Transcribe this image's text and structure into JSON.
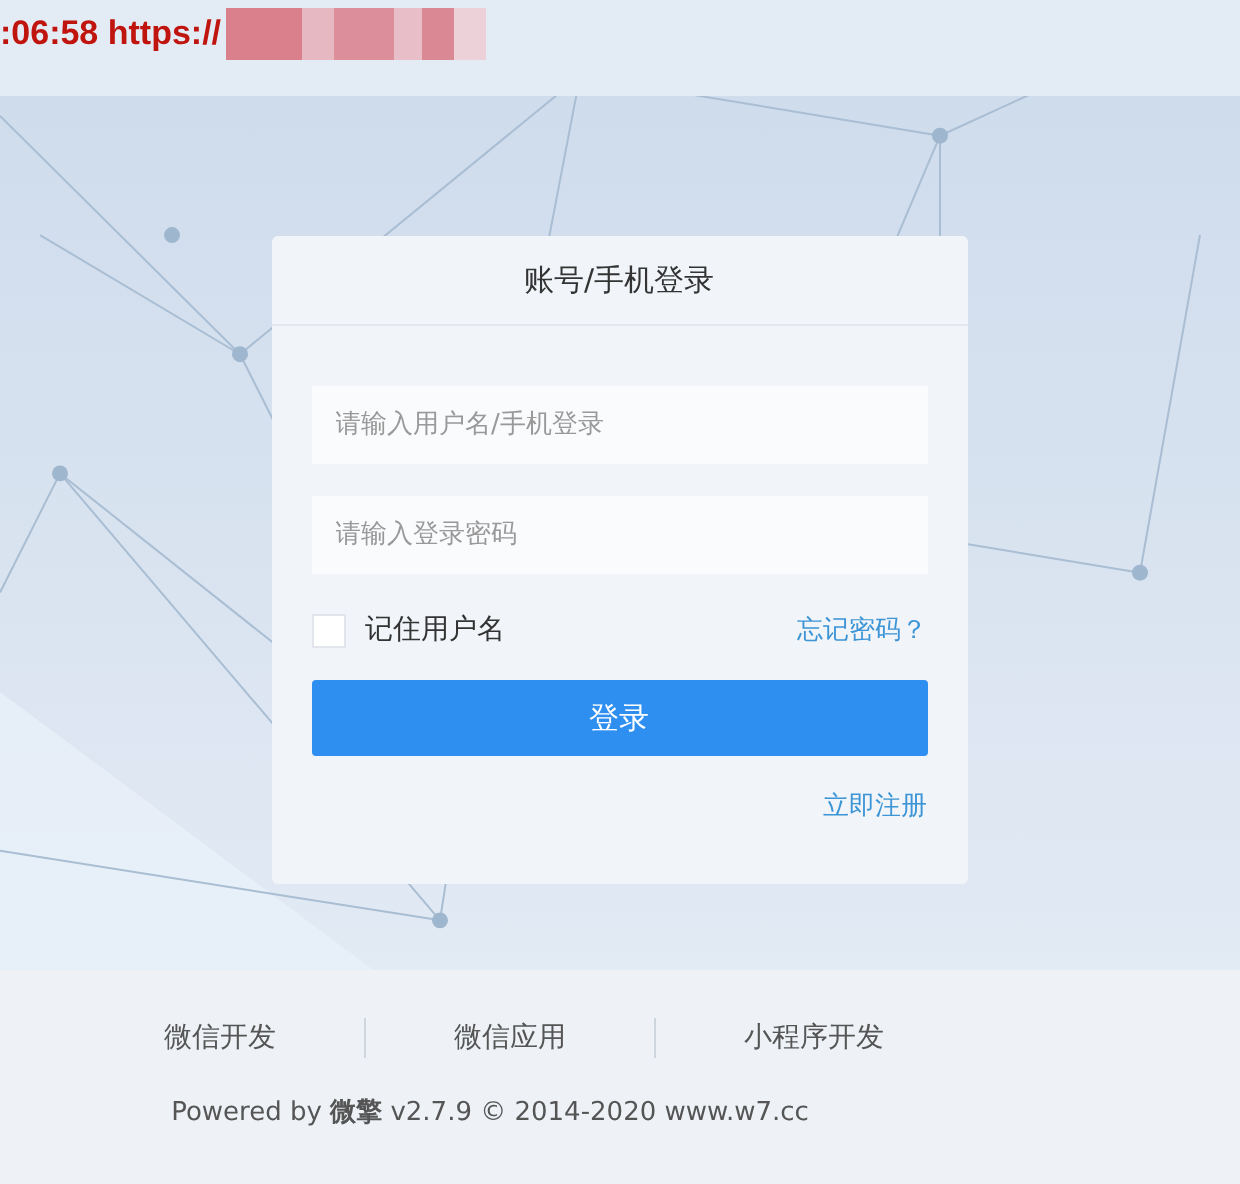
{
  "overlay": {
    "text": ":06:58 https://"
  },
  "login": {
    "title": "账号/手机登录",
    "fields": [
      {
        "placeholder": "请输入用户名/手机登录"
      },
      {
        "placeholder": "请输入登录密码"
      }
    ],
    "remember": {
      "label": "记住用户名",
      "checked": false
    },
    "forgot": "忘记密码？",
    "submit": "登录",
    "register": "立即注册"
  },
  "footer": {
    "links": [
      "微信开发",
      "微信应用",
      "小程序开发"
    ],
    "copyright": "Powered by **微擎** v2.7.9 © 2014-2020 www.w7.cc"
  }
}
